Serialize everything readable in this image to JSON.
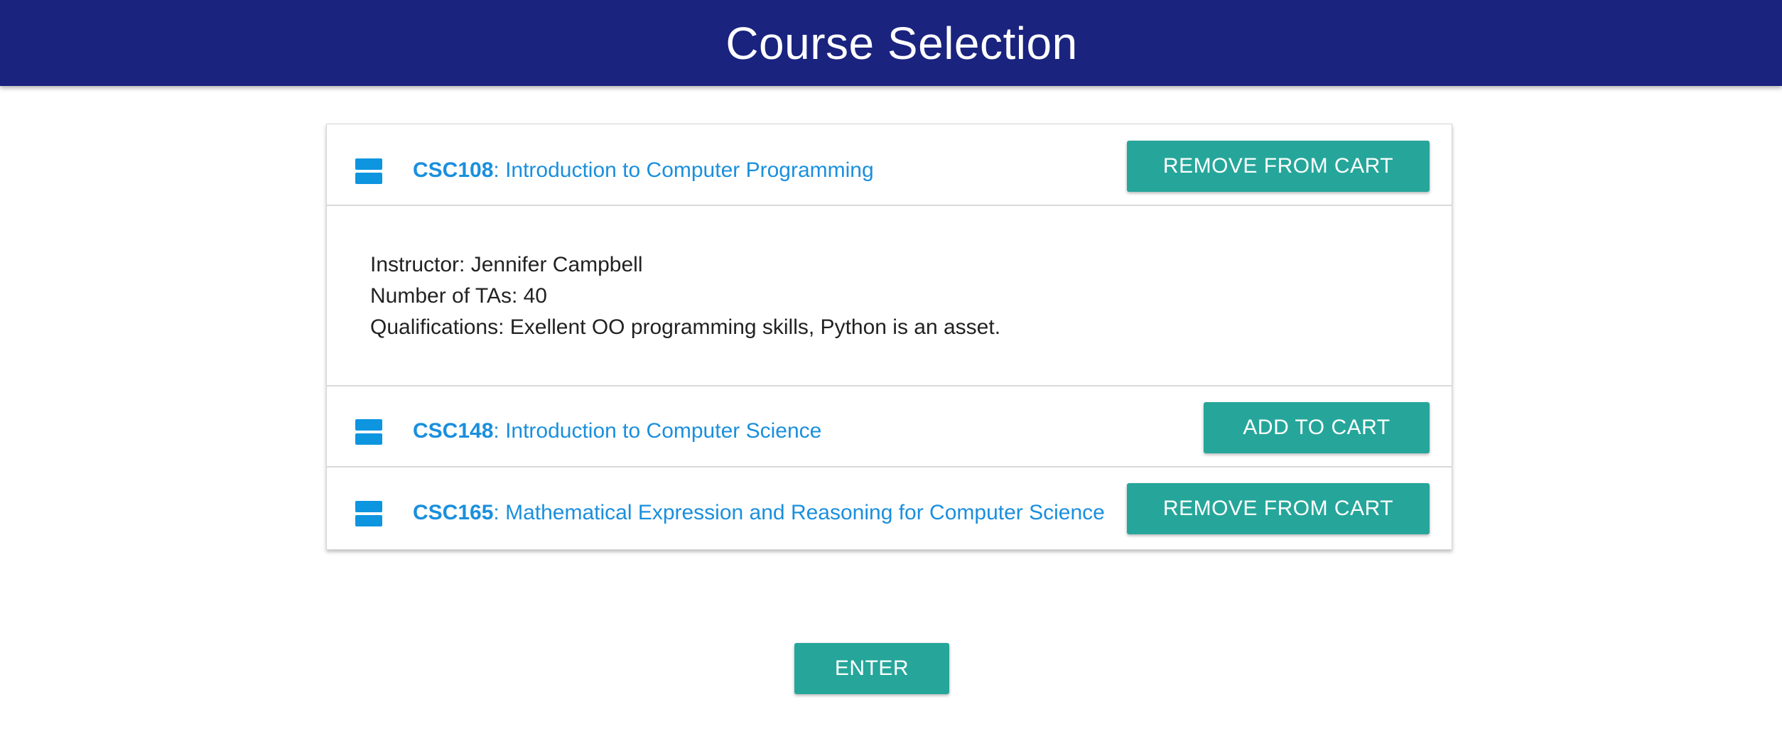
{
  "header": {
    "title": "Course Selection"
  },
  "courses": [
    {
      "code": "CSC108",
      "name": ": Introduction to Computer Programming",
      "button_label": "REMOVE FROM CART",
      "expanded": true,
      "details": {
        "instructor": "Instructor: Jennifer Campbell",
        "num_tas": "Number of TAs: 40",
        "qualifications": "Qualifications: Exellent OO programming skills, Python is an asset."
      }
    },
    {
      "code": "CSC148",
      "name": ": Introduction to Computer Science",
      "button_label": "ADD TO CART",
      "expanded": false
    },
    {
      "code": "CSC165",
      "name": ": Mathematical Expression and Reasoning for Computer Science",
      "button_label": "REMOVE FROM CART",
      "expanded": false
    }
  ],
  "enter_button": {
    "label": "ENTER"
  },
  "colors": {
    "app_bar": "#1a237e",
    "accent_button": "#26a69a",
    "link_blue": "#1a8fdd",
    "icon_blue": "#0d95e0"
  },
  "icons": {
    "course_icon": "view-stream-icon"
  }
}
